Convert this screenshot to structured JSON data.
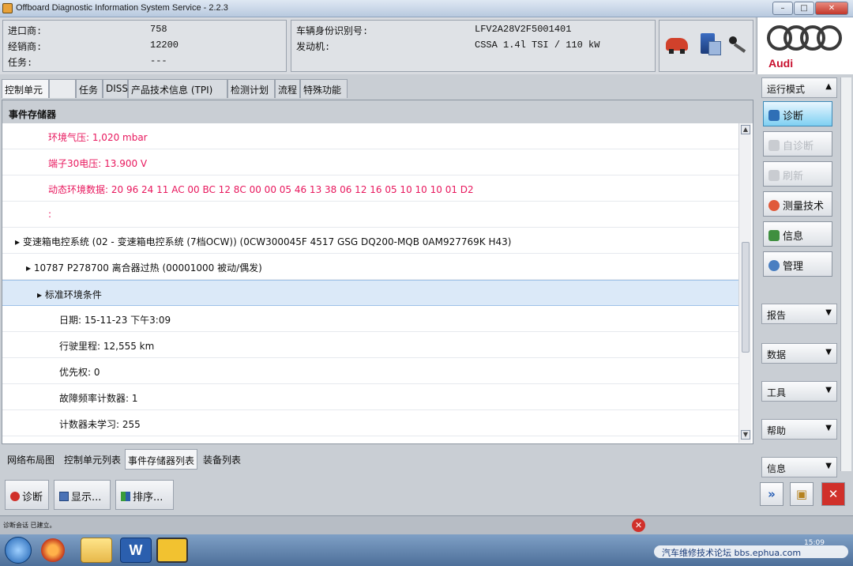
{
  "window": {
    "title": "Offboard Diagnostic Information System Service - 2.2.3",
    "buttons": [
      "–",
      "□",
      "✕"
    ]
  },
  "vehicle_info": {
    "left": [
      {
        "label": "进口商:",
        "value": "758"
      },
      {
        "label": "经销商:",
        "value": "12200"
      },
      {
        "label": "任务:",
        "value": "---"
      }
    ],
    "right": [
      {
        "label": "车辆身份识别号:",
        "value": "LFV2A28V2F5001401"
      },
      {
        "label": "发动机:",
        "value": "CSSA 1.4l TSI / 110 kW"
      }
    ]
  },
  "brand": {
    "name": "Audi",
    "accent": "#c8102e"
  },
  "tabs": [
    "控制单元",
    "任务",
    "DISS",
    "产品技术信息 (TPI)",
    "检测计划",
    "流程",
    "特殊功能"
  ],
  "panel": {
    "title": "事件存储器",
    "rows": [
      {
        "text": "环境气压: 1,020 mbar",
        "style": "pink"
      },
      {
        "text": "端子30电压: 13.900 V",
        "style": "pink"
      },
      {
        "text": "动态环境数据: 20 96 24 11 AC 00 BC 12 8C 00 00 05 46 13 38 06 12 16 05 10 10 10 01 D2",
        "style": "pink"
      },
      {
        "text": ":",
        "style": "pink"
      },
      {
        "text": "▸ 变速箱电控系统 (02 - 变速箱电控系统 (7档OCW)) (0CW300045F    4517   GSG DQ200-MQB    0AM927769K    H43)",
        "style": "normal"
      },
      {
        "text": "▸ 10787   P278700   离合器过热  (00001000   被动/偶发)",
        "style": "normal"
      },
      {
        "text": "▸ 标准环境条件",
        "style": "selected"
      },
      {
        "text": "日期: 15-11-23 下午3:09",
        "style": "normal"
      },
      {
        "text": "行驶里程: 12,555 km",
        "style": "normal"
      },
      {
        "text": "优先权: 0",
        "style": "normal"
      },
      {
        "text": "故障频率计数器: 1",
        "style": "normal"
      },
      {
        "text": "计数器未学习: 255",
        "style": "normal"
      }
    ]
  },
  "bottom_tabs": [
    "网络布局图",
    "控制单元列表",
    "事件存储器列表",
    "装备列表"
  ],
  "bottom_buttons": [
    {
      "label": "诊断",
      "icon": "stop-icon"
    },
    {
      "label": "显示...",
      "icon": "display-icon"
    },
    {
      "label": "排序...",
      "icon": "sort-icon"
    }
  ],
  "sidebar": {
    "mode_header": "运行模式",
    "mode_buttons": [
      {
        "label": "诊断",
        "state": "active"
      },
      {
        "label": "自诊断",
        "state": "disabled"
      },
      {
        "label": "刷新",
        "state": "disabled"
      },
      {
        "label": "测量技术",
        "state": "normal"
      },
      {
        "label": "信息",
        "state": "normal"
      },
      {
        "label": "管理",
        "state": "normal"
      }
    ],
    "sections": [
      "报告",
      "数据",
      "工具",
      "帮助",
      "信息"
    ],
    "nav": [
      "»",
      "▣",
      "✕"
    ]
  },
  "status": {
    "text": "诊断会话 已建立。"
  },
  "taskbar": {
    "clock": "15:09"
  },
  "watermark": "汽车维修技术论坛 bbs.ephua.com"
}
